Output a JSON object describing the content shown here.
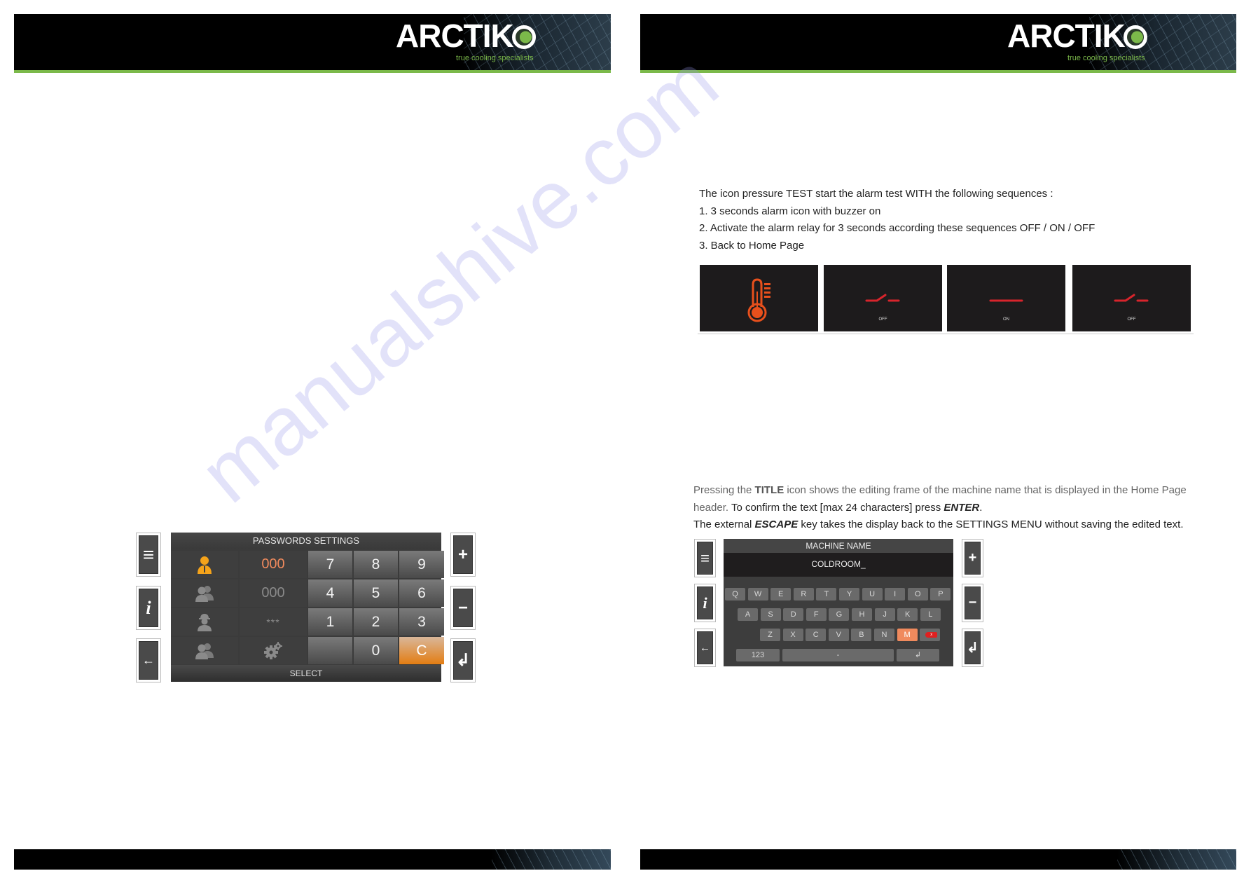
{
  "brand": {
    "name": "ARCTIK",
    "tagline": "true cooling specialists",
    "accent_color": "#7bb94a"
  },
  "left_page": {
    "passwords_panel": {
      "title": "PASSWORDS SETTINGS",
      "rows": [
        {
          "icon": "user-icon",
          "code": "000",
          "state": "active"
        },
        {
          "icon": "users-icon",
          "code": "000",
          "state": "inactive"
        },
        {
          "icon": "technician-icon",
          "code": "***",
          "state": "inactive"
        },
        {
          "icon": "users-icon",
          "code": "gear-icon",
          "state": "inactive"
        }
      ],
      "keypad": [
        "7",
        "8",
        "9",
        "4",
        "5",
        "6",
        "1",
        "2",
        "3",
        "",
        "0",
        "C"
      ],
      "select_label": "SELECT",
      "active_color": "#f5a31a",
      "clear_color": "#e37d12"
    },
    "side_buttons_left": [
      "menu-icon",
      "info-icon",
      "back-arrow-icon"
    ],
    "side_buttons_right": [
      "plus-icon",
      "minus-icon",
      "enter-icon"
    ],
    "side_glyphs": {
      "menu": "≡",
      "info": "i",
      "back": "←",
      "plus": "+",
      "minus": "−",
      "enter": "↲"
    }
  },
  "right_page": {
    "alarm_test": {
      "intro": "The icon pressure TEST start the alarm test WITH the following sequences :",
      "steps": [
        "1. 3 seconds alarm icon with buzzer on",
        "2. Activate the alarm relay for 3 seconds according these sequences OFF / ON / OFF",
        "3. Back to Home Page"
      ],
      "images": [
        {
          "icon": "thermometer-alarm-icon",
          "label": ""
        },
        {
          "icon": "relay-open-icon",
          "label": "OFF"
        },
        {
          "icon": "relay-closed-icon",
          "label": "ON"
        },
        {
          "icon": "relay-open-icon",
          "label": "OFF"
        }
      ]
    },
    "title_edit": {
      "p1_grey_a": "Pressing the ",
      "p1_bold": "TITLE",
      "p1_grey_b": " icon shows the editing frame of the machine name that is displayed in the Home Page",
      "p2_grey": "header.",
      "p2_black": " To confirm the text [max 24 characters] press ",
      "p2_bold": "ENTER",
      "p2_end": ".",
      "p3_a": "The external ",
      "p3_bold": "ESCAPE",
      "p3_b": " key takes the display back to the SETTINGS MENU without saving the edited text."
    },
    "keyboard_panel": {
      "title": "MACHINE NAME",
      "value": "COLDROOM_",
      "row1": [
        "Q",
        "W",
        "E",
        "R",
        "T",
        "Y",
        "U",
        "I",
        "O",
        "P"
      ],
      "row2": [
        "A",
        "S",
        "D",
        "F",
        "G",
        "H",
        "J",
        "K",
        "L"
      ],
      "row3": [
        "Z",
        "X",
        "C",
        "V",
        "B",
        "N",
        "M"
      ],
      "backspace_label": "x",
      "mode_label": "123",
      "space_label": "-",
      "enter_label": "↲",
      "highlight_key": "M"
    }
  },
  "watermark": "manualshive.com"
}
